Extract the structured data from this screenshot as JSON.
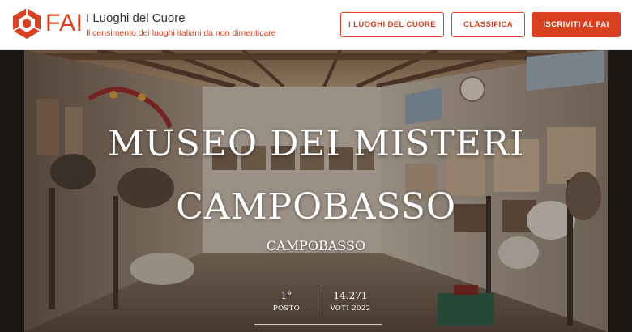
{
  "header": {
    "brand": "FAI",
    "title": "I Luoghi del Cuore",
    "subtitle": "Il censimento dei luoghi italiani da non dimenticare",
    "buttons": {
      "luoghi": "I LUOGHI DEL CUORE",
      "classifica": "CLASSIFICA",
      "iscriviti": "ISCRIVITI AL FAI"
    },
    "icons": {
      "logo": "fai-logo-icon"
    },
    "colors": {
      "accent": "#d9401f"
    }
  },
  "hero": {
    "title_line1": "MUSEO DEI MISTERI",
    "title_line2": "CAMPOBASSO",
    "city": "CAMPOBASSO",
    "stats": {
      "rank_value": "1°",
      "rank_label": "POSTO",
      "votes_value": "14.271",
      "votes_label": "VOTI 2022"
    }
  }
}
